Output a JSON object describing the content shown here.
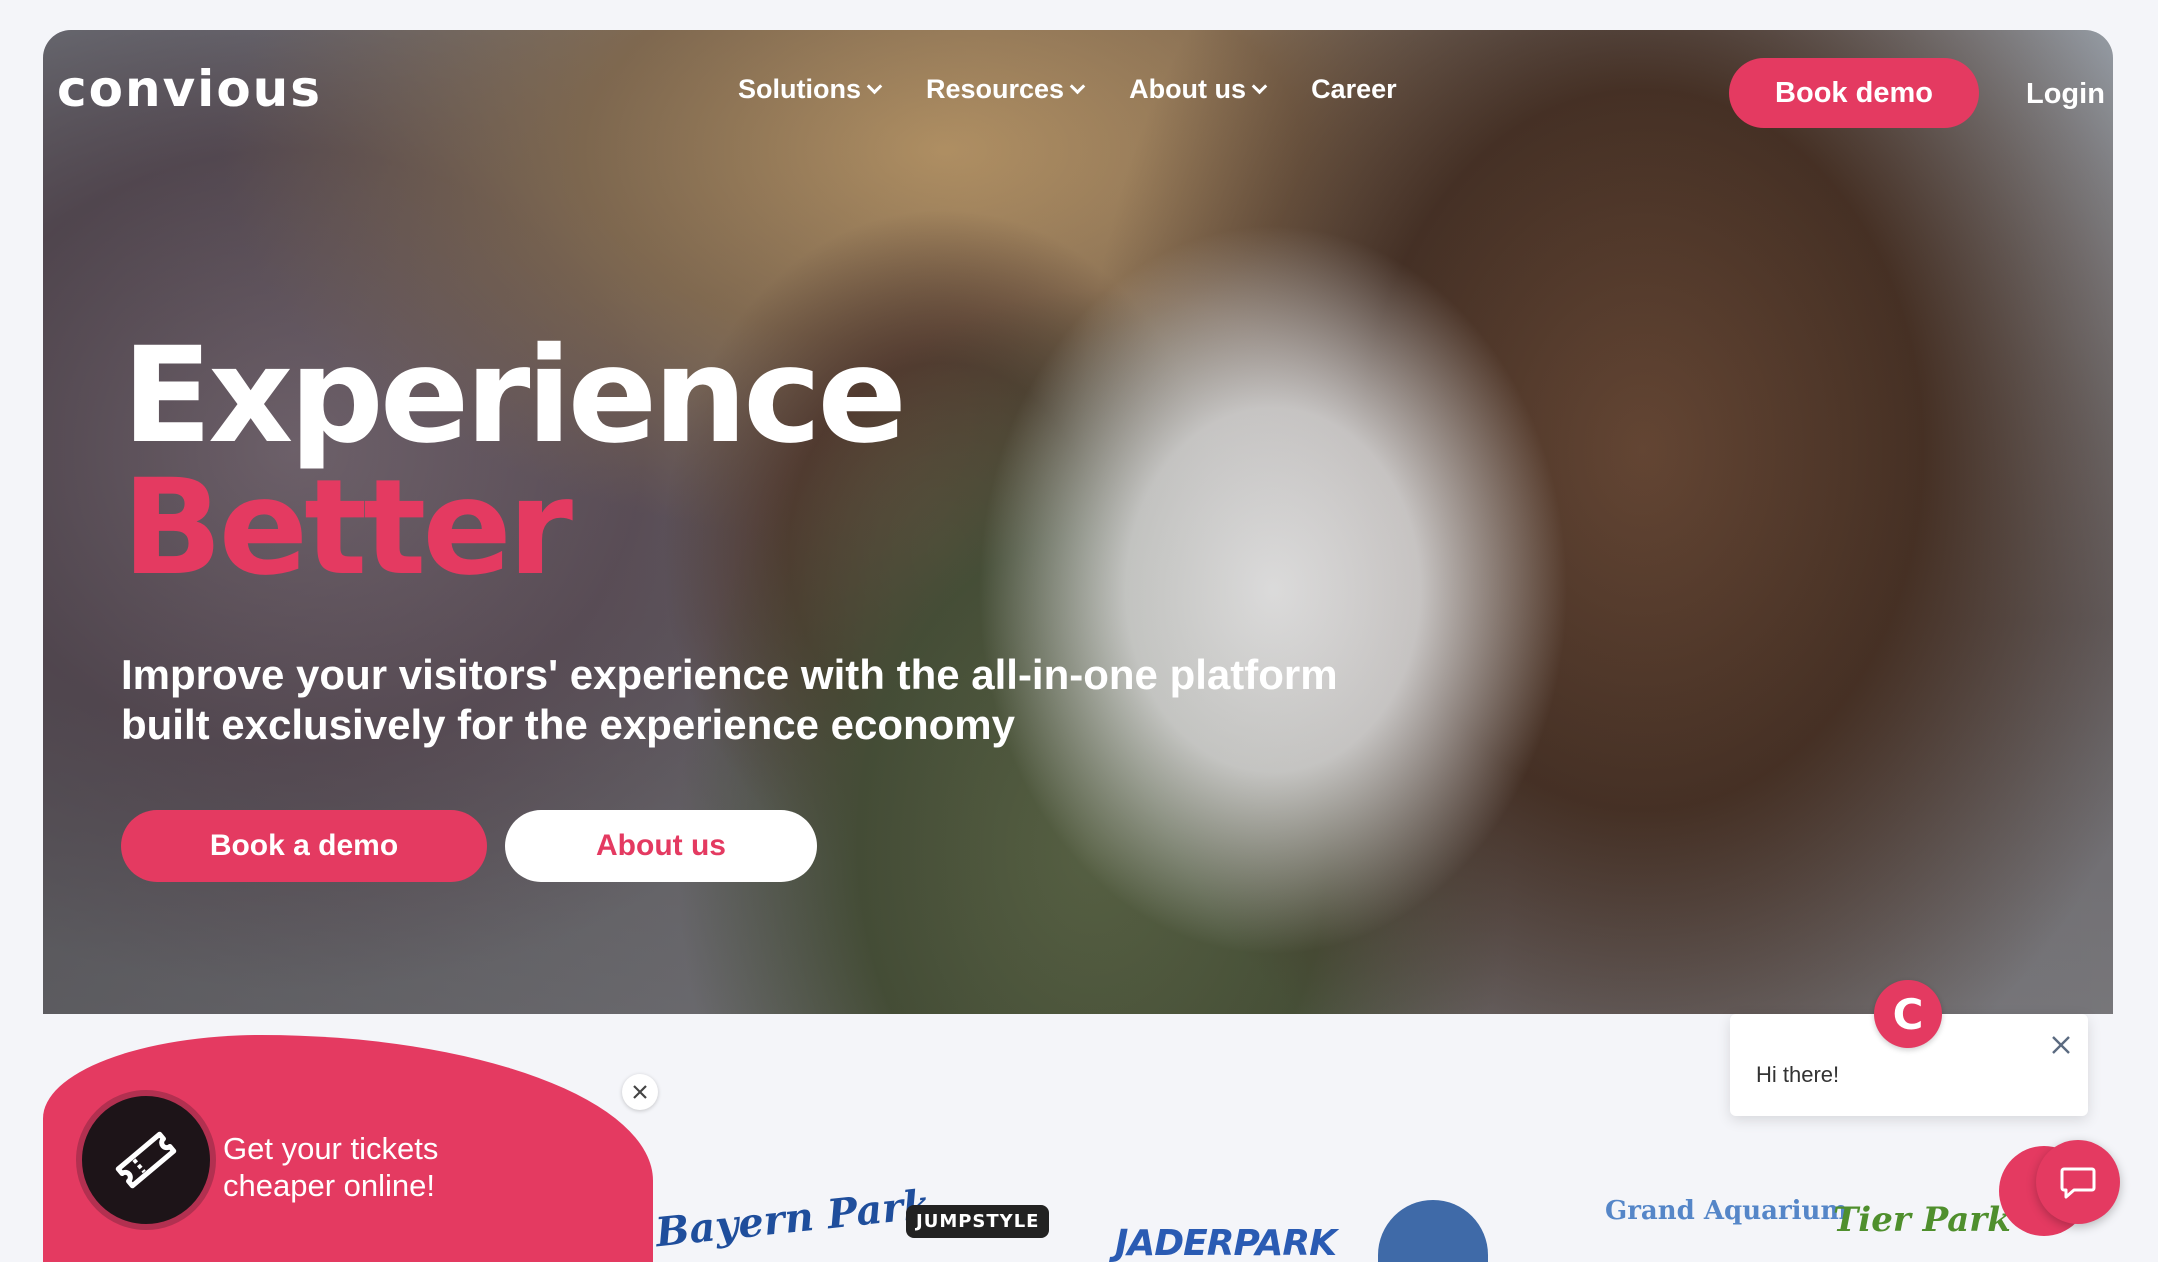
{
  "header": {
    "logo": "convious",
    "nav": [
      {
        "label": "Solutions",
        "has_dropdown": true
      },
      {
        "label": "Resources",
        "has_dropdown": true
      },
      {
        "label": "About us",
        "has_dropdown": true
      },
      {
        "label": "Career",
        "has_dropdown": false
      }
    ],
    "book_demo_label": "Book demo",
    "login_label": "Login"
  },
  "hero": {
    "headline_line1": "Experience",
    "headline_line2": "Better",
    "subtext": "Improve your visitors' experience with the all-in-one platform built exclusively for the experience economy",
    "cta_primary": "Book a demo",
    "cta_secondary": "About us"
  },
  "promo": {
    "text_line1": "Get your tickets",
    "text_line2": "cheaper online!",
    "icon": "ticket-icon"
  },
  "partners": [
    "Bayern Park",
    "JUMPSTYLE",
    "JADERPARK",
    "Grand Aquarium",
    "Tier Park"
  ],
  "chat": {
    "avatar_letter": "C",
    "greeting": "Hi there!"
  },
  "colors": {
    "accent": "#e43a61",
    "background": "#f4f5f9",
    "white": "#ffffff"
  }
}
